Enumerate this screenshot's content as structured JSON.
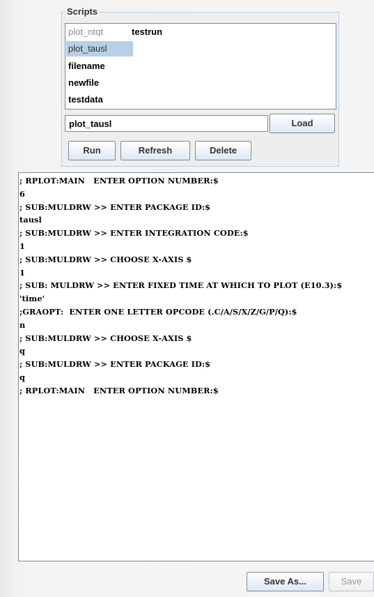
{
  "scripts_panel": {
    "title": "Scripts",
    "list": [
      {
        "label": "plot_ntqt",
        "style": "muted"
      },
      {
        "label": "testrun",
        "style": "normal"
      },
      {
        "label": "plot_tausl",
        "style": "selected"
      },
      {
        "label": "filename",
        "style": "normal"
      },
      {
        "label": "newfile",
        "style": "normal"
      },
      {
        "label": "testdata",
        "style": "normal"
      }
    ],
    "input_value": "plot_tausl",
    "load_label": "Load",
    "run_label": "Run",
    "refresh_label": "Refresh",
    "delete_label": "Delete"
  },
  "console": {
    "lines": [
      "; RPLOT:MAIN   ENTER OPTION NUMBER:$",
      "6",
      "; SUB:MULDRW >> ENTER PACKAGE ID:$",
      "tausl",
      "; SUB:MULDRW >> ENTER INTEGRATION CODE:$",
      "1",
      "; SUB:MULDRW >> CHOOSE X-AXIS $",
      "1",
      "; SUB: MULDRW >> ENTER FIXED TIME AT WHICH TO PLOT (E10.3):$",
      "'time'",
      ";GRAOPT:  ENTER ONE LETTER OPCODE (.C/A/S/X/Z/G/P/Q):$",
      "n",
      "; SUB:MULDRW >> CHOOSE X-AXIS $",
      "q",
      "; SUB:MULDRW >> ENTER PACKAGE ID:$",
      "q",
      "; RPLOT:MAIN   ENTER OPTION NUMBER:$"
    ]
  },
  "footer": {
    "save_as_label": "Save As...",
    "save_label": "Save"
  }
}
